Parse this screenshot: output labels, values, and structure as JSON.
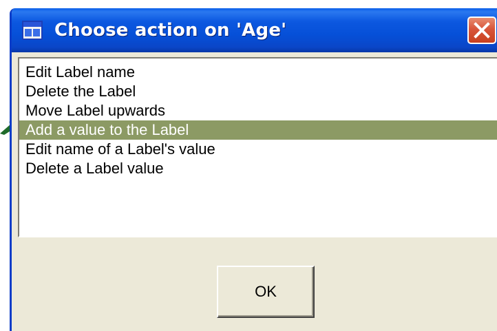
{
  "window": {
    "title": "Choose action on 'Age'",
    "title_bar_color": "#0a5fe8"
  },
  "icons": {
    "app": "application-window-icon",
    "close": "close-x-icon",
    "pointer": "green-arrow-pointer-icon"
  },
  "list": {
    "items": [
      "Edit Label name",
      "Delete the Label",
      "Move Label upwards",
      "Add a value to the Label",
      "Edit name of a Label's value",
      "Delete a Label value"
    ],
    "selected_index": 3,
    "selected_value": "Add a value to the Label",
    "selection_color": "#8c9a64"
  },
  "buttons": {
    "ok_label": "OK"
  },
  "colors": {
    "dialog_face": "#ece9d8",
    "pointer_arrow": "#1f6b2a"
  }
}
